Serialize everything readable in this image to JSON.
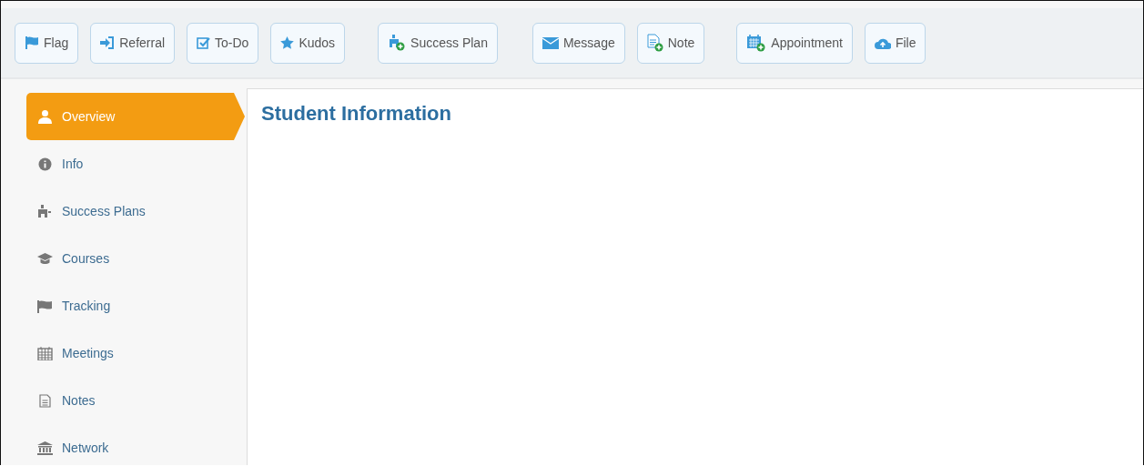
{
  "toolbar": {
    "buttons": [
      {
        "label": "Flag"
      },
      {
        "label": "Referral"
      },
      {
        "label": "To-Do"
      },
      {
        "label": "Kudos"
      },
      {
        "label": "Success Plan"
      },
      {
        "label": "Message"
      },
      {
        "label": "Note"
      },
      {
        "label": "Appointment"
      },
      {
        "label": "File"
      }
    ]
  },
  "sidebar": {
    "items": [
      {
        "label": "Overview",
        "selected": true
      },
      {
        "label": "Info",
        "selected": false
      },
      {
        "label": "Success Plans",
        "selected": false
      },
      {
        "label": "Courses",
        "selected": false
      },
      {
        "label": "Tracking",
        "selected": false
      },
      {
        "label": "Meetings",
        "selected": false
      },
      {
        "label": "Notes",
        "selected": false
      },
      {
        "label": "Network",
        "selected": false
      }
    ]
  },
  "main": {
    "title": "Student Information"
  }
}
